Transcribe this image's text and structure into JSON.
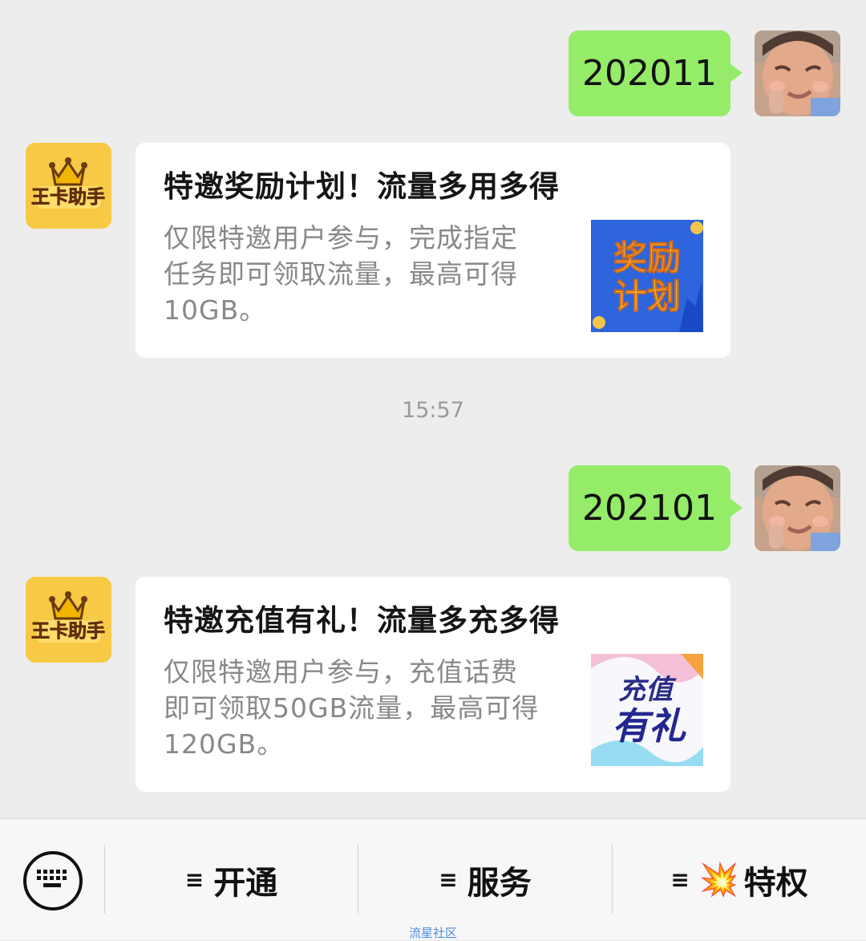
{
  "messages": [
    {
      "type": "outgoing",
      "text": "202011"
    },
    {
      "type": "incoming_card",
      "title": "特邀奖励计划！流量多用多得",
      "description_lines": [
        "仅限特邀用户参与，完成指定",
        "任务即可领取流量，最高可得",
        "10GB。"
      ],
      "thumbnail_text_lines": [
        "奖励",
        "计划"
      ]
    },
    {
      "type": "outgoing",
      "text": "202101"
    },
    {
      "type": "incoming_card",
      "title": "特邀充值有礼！流量多充多得",
      "description_lines": [
        "仅限特邀用户参与，充值话费",
        "即可领取50GB流量，最高可得",
        "120GB。"
      ],
      "thumbnail_text_lines": [
        "充值",
        "有礼"
      ]
    }
  ],
  "bot_avatar_text": "王卡助手",
  "timestamp": "15:57",
  "bottom_menu": {
    "items": [
      {
        "label": "开通",
        "icon": "menu-lines-icon"
      },
      {
        "label": "服务",
        "icon": "menu-lines-icon"
      },
      {
        "label": "特权",
        "icon": "explosion-icon"
      }
    ],
    "keyboard_icon": "keyboard-icon",
    "menu_glyph": "≡",
    "explosion_glyph": "💥"
  },
  "footer": "流星社区",
  "colors": {
    "background": "#ededed",
    "outgoing_bubble": "#95ec69",
    "card": "#ffffff",
    "footer_link": "#4a8de4"
  }
}
